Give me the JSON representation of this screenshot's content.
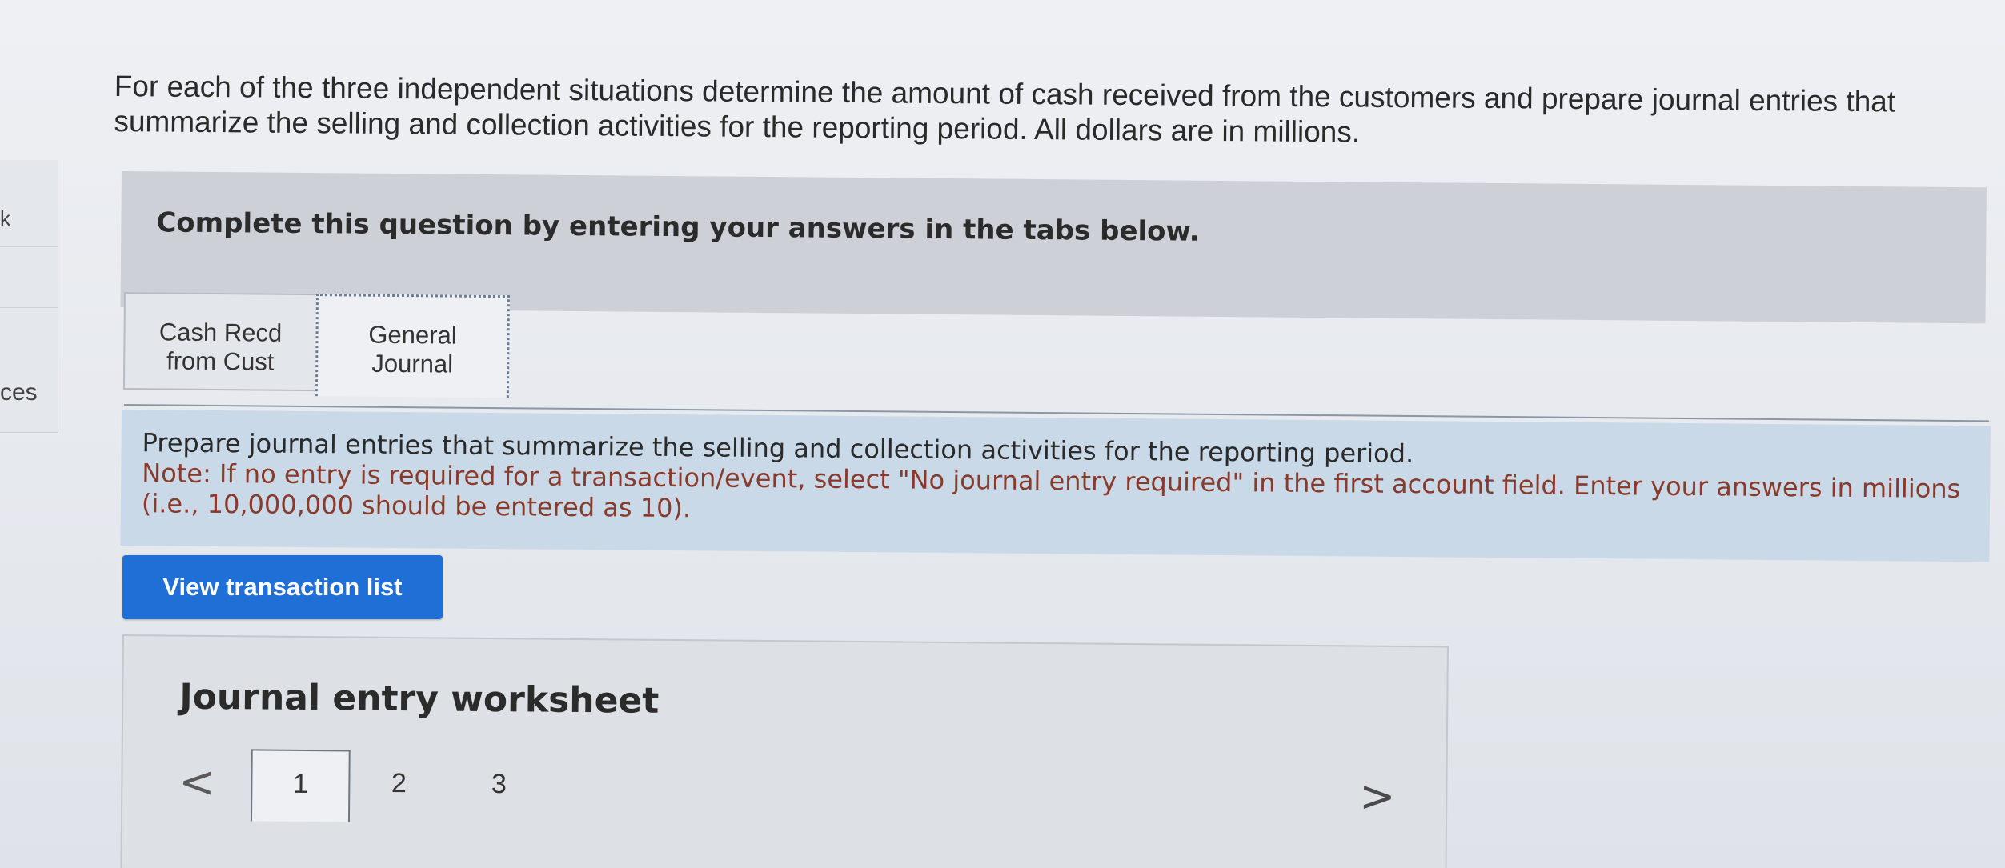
{
  "intro": {
    "text": "For each of the three independent situations determine the amount of cash received from the customers and prepare journal entries that summarize the selling and collection activities for the reporting period. All dollars are in millions."
  },
  "banner": {
    "text": "Complete this question by entering your answers in the tabs below."
  },
  "tabs": [
    {
      "line1": "Cash Recd",
      "line2": "from Cust",
      "active": false
    },
    {
      "line1": "General",
      "line2": "Journal",
      "active": true
    }
  ],
  "instructions": {
    "main": "Prepare journal entries that summarize the selling and collection activities for the reporting period.",
    "note": "Note: If no entry is required for a transaction/event, select \"No journal entry required\" in the first account field. Enter your answers in millions (i.e., 10,000,000 should be entered as 10)."
  },
  "buttons": {
    "view_transactions": "View transaction list"
  },
  "worksheet": {
    "title": "Journal entry worksheet",
    "prev": "<",
    "next": ">",
    "pages": [
      "1",
      "2",
      "3"
    ],
    "current_page": "1"
  },
  "sidebar_fragment": {
    "glyph": "k",
    "text": "ces"
  }
}
